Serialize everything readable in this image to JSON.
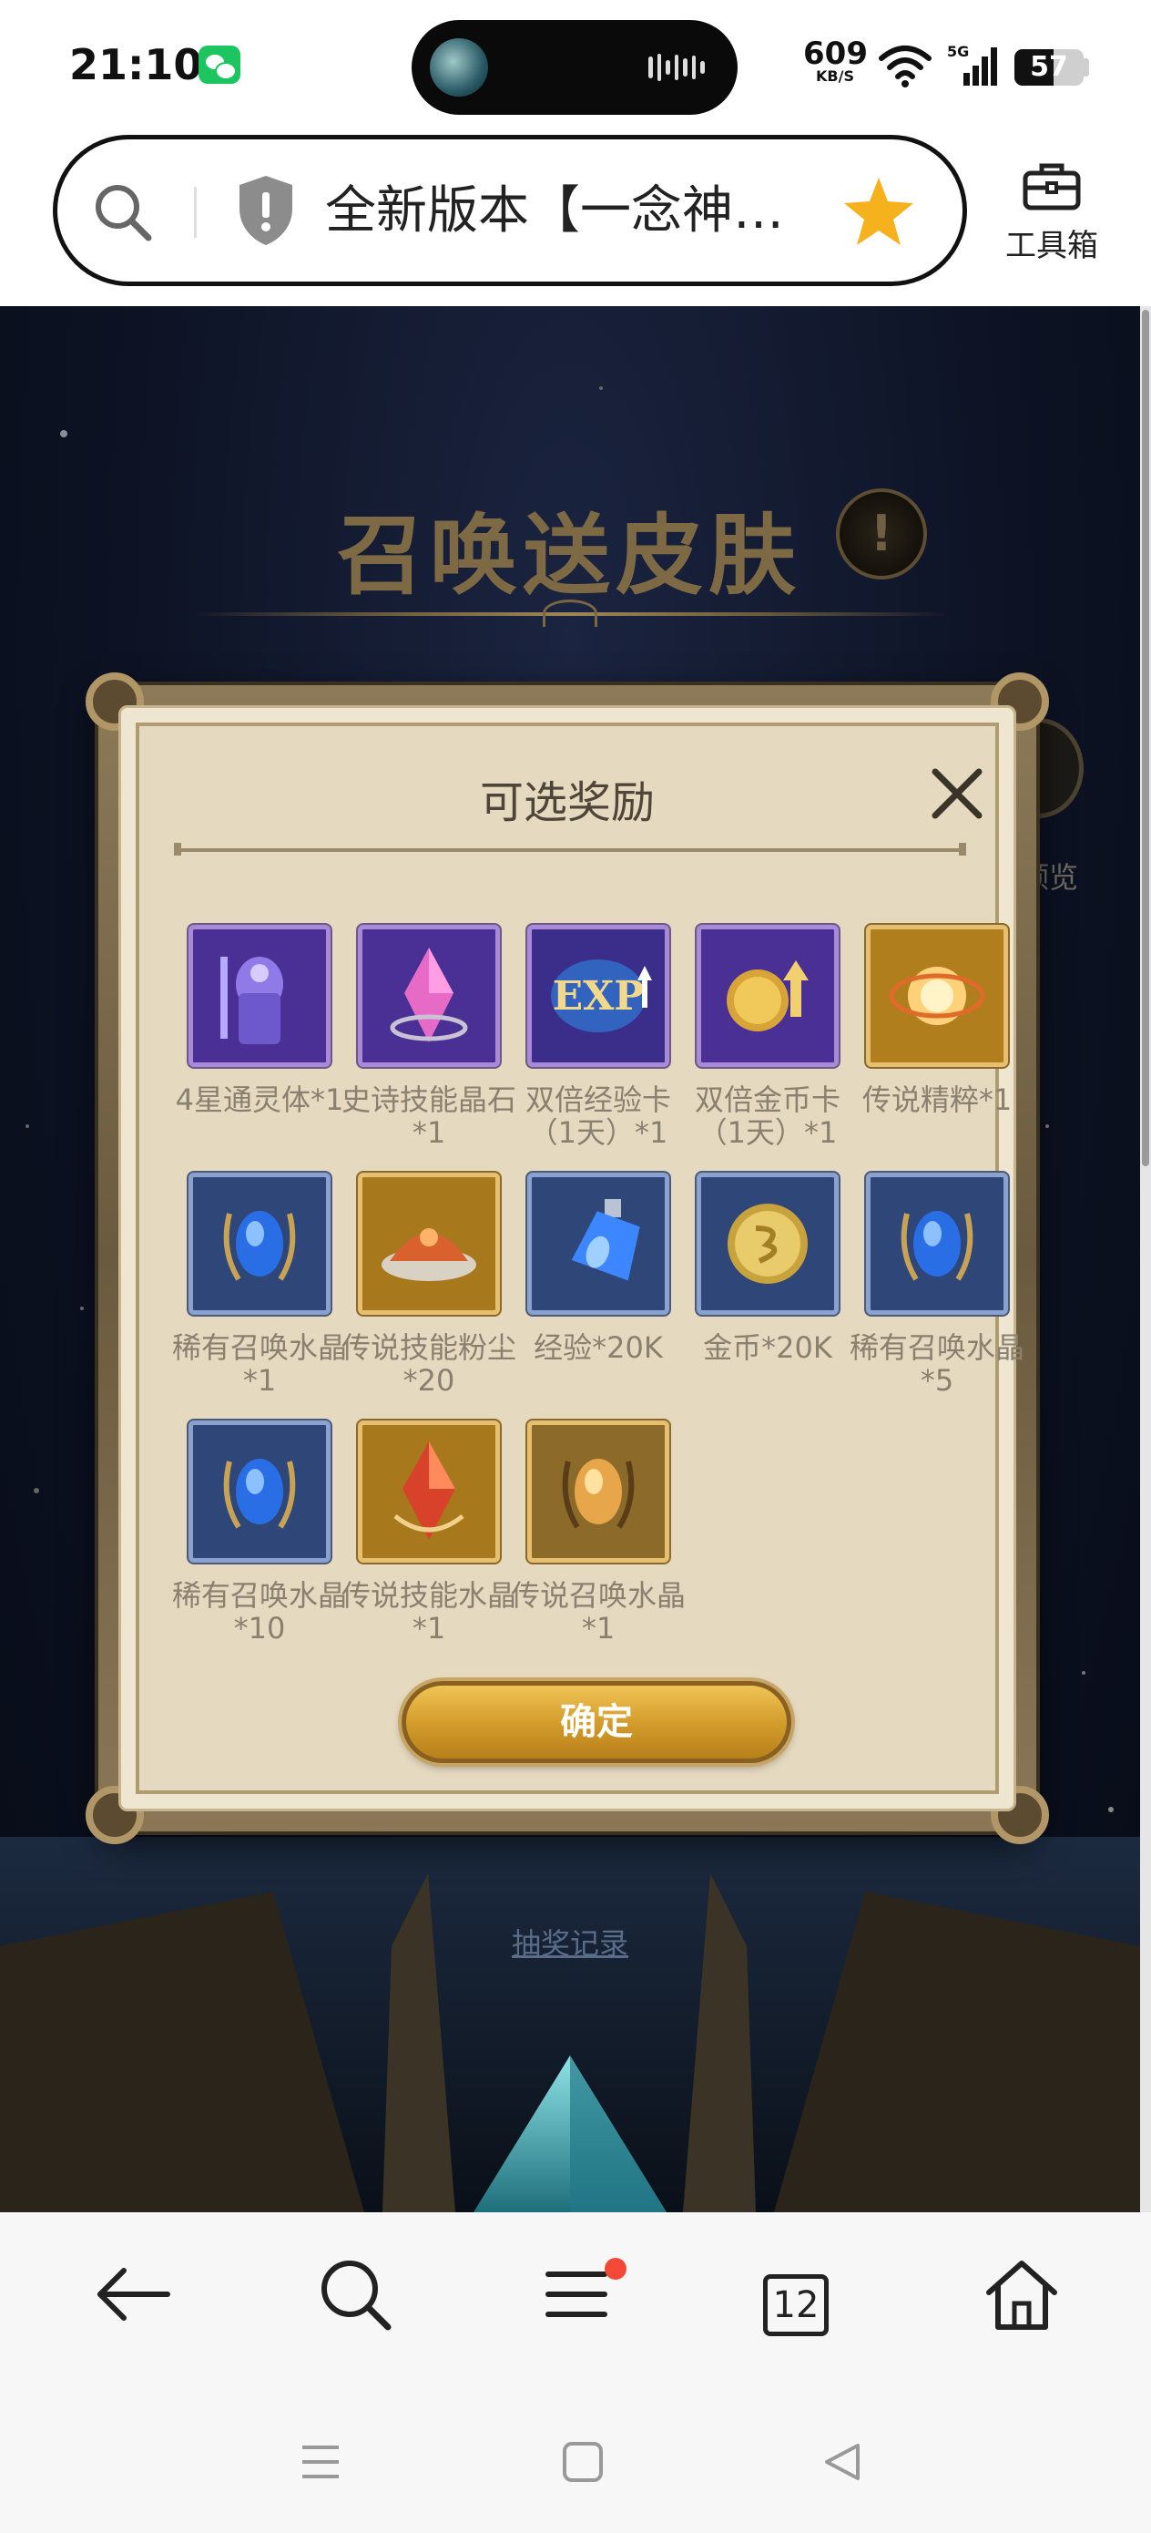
{
  "status_bar": {
    "time": "21:10",
    "network_speed": "609",
    "network_unit": "KB/S",
    "signal_label": "5G",
    "battery": "57",
    "battery_level": 0.57,
    "icons": [
      "wechat-icon",
      "wifi-icon",
      "signal-icon",
      "battery-icon"
    ]
  },
  "address_bar": {
    "page_title": "全新版本【一念神…",
    "toolbox_label": "工具箱",
    "icons": [
      "search-icon",
      "shield-icon",
      "star-icon",
      "toolbox-icon"
    ],
    "star_color": "#f6b21d"
  },
  "game_page": {
    "heading": "召唤送皮肤",
    "info_icon": "!",
    "preview_partial": "预览",
    "lottery_link": "抽奖记录"
  },
  "modal": {
    "title": "可选奖励",
    "confirm_label": "确定",
    "items": [
      {
        "label": "4星通灵体*1",
        "rarity": "purple",
        "icon": "knight-statue-icon"
      },
      {
        "label": "史诗技能晶石*1",
        "rarity": "purple",
        "icon": "crystal-icon"
      },
      {
        "label": "双倍经验卡（1天）*1",
        "rarity": "purple",
        "icon": "exp-card-icon"
      },
      {
        "label": "双倍金币卡（1天）*1",
        "rarity": "purple",
        "icon": "gold-card-icon"
      },
      {
        "label": "传说精粹*1",
        "rarity": "gold",
        "icon": "essence-orb-icon"
      },
      {
        "label": "稀有召唤水晶*1",
        "rarity": "blue",
        "icon": "blue-gem-icon"
      },
      {
        "label": "传说技能粉尘*20",
        "rarity": "gold",
        "icon": "dust-bowl-icon"
      },
      {
        "label": "经验*20K",
        "rarity": "blue",
        "icon": "potion-icon"
      },
      {
        "label": "金币*20K",
        "rarity": "blue",
        "icon": "coin-icon"
      },
      {
        "label": "稀有召唤水晶*5",
        "rarity": "blue",
        "icon": "blue-gem-icon"
      },
      {
        "label": "稀有召唤水晶*10",
        "rarity": "blue",
        "icon": "blue-gem-icon"
      },
      {
        "label": "传说技能水晶*1",
        "rarity": "gold",
        "icon": "red-crystal-icon"
      },
      {
        "label": "传说召唤水晶*1",
        "rarity": "gold",
        "icon": "amber-gem-icon"
      }
    ]
  },
  "bottom_nav": {
    "tab_count": "12",
    "icons": [
      "back-arrow-icon",
      "search-icon",
      "menu-icon",
      "tabs-icon",
      "home-icon"
    ]
  },
  "system_nav": {
    "icons": [
      "recents-icon",
      "home-square-icon",
      "back-triangle-icon"
    ]
  }
}
